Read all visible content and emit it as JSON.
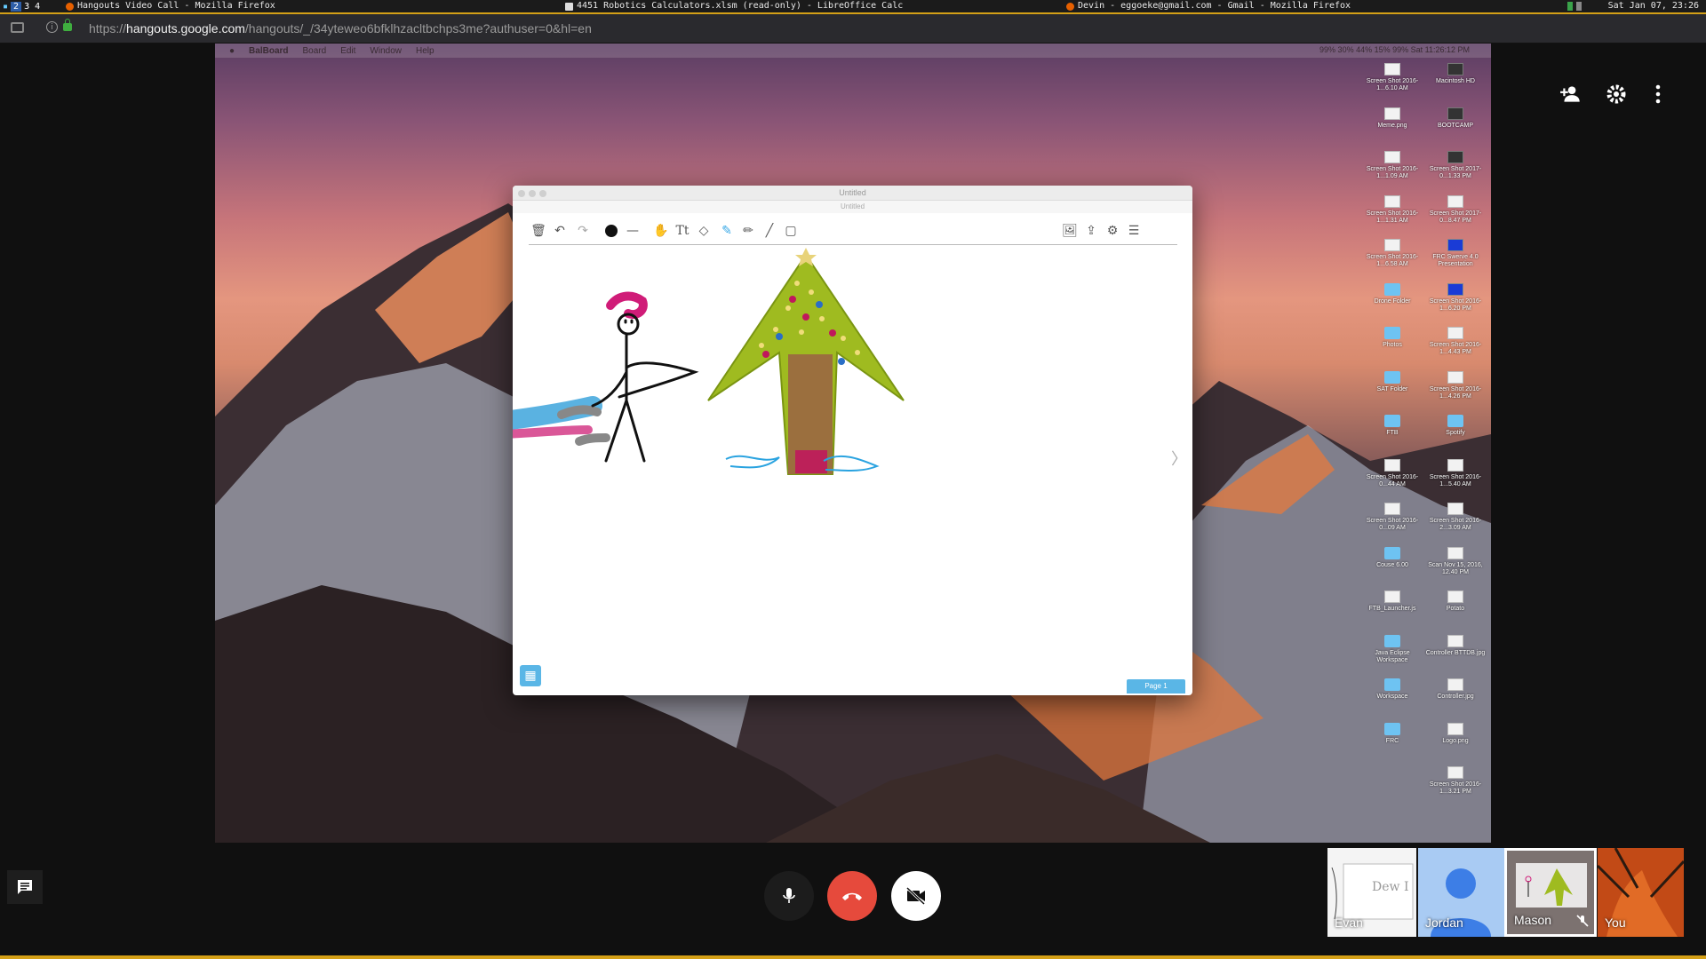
{
  "wm": {
    "workspaces": [
      "2",
      "3",
      "4"
    ],
    "window_titles": [
      "Hangouts Video Call - Mozilla Firefox",
      "4451 Robotics Calculators.xlsm (read-only) - LibreOffice Calc",
      "Devin - eggoeke@gmail.com - Gmail - Mozilla Firefox"
    ],
    "clock": "Sat Jan 07, 23:26"
  },
  "browser": {
    "url_prefix": "https://",
    "url_host": "hangouts.google.com",
    "url_path": "/hangouts/_/34yteweo6bfklhzacltbchps3me?authuser=0&hl=en"
  },
  "shared_screen": {
    "menubar": [
      "BalBoard",
      "Board",
      "Edit",
      "Window",
      "Help"
    ],
    "status": "99%  30%  44%  15%  99%  Sat 11:26:12 PM",
    "desktop_icons": [
      {
        "label": "Screen Shot 2016-1...6.10 AM",
        "kind": "file"
      },
      {
        "label": "Macintosh HD",
        "kind": "dark"
      },
      {
        "label": "Meme.png",
        "kind": "file"
      },
      {
        "label": "BOOTCAMP",
        "kind": "dark"
      },
      {
        "label": "Screen Shot 2016-1...1.09 AM",
        "kind": "file"
      },
      {
        "label": "Screen Shot 2017-0...1.33 PM",
        "kind": "dark"
      },
      {
        "label": "Screen Shot 2016-1...1.31 AM",
        "kind": "file"
      },
      {
        "label": "Screen Shot 2017-0...8.47 PM",
        "kind": "file"
      },
      {
        "label": "Screen Shot 2016-1...6.58 AM",
        "kind": "file"
      },
      {
        "label": "FRC Swerve 4.0 Presentation",
        "kind": "blue"
      },
      {
        "label": "Drone Folder",
        "kind": "folder"
      },
      {
        "label": "Screen Shot 2016-1...6.20 PM",
        "kind": "blue"
      },
      {
        "label": "Photos",
        "kind": "folder"
      },
      {
        "label": "Screen Shot 2016-1...4.43 PM",
        "kind": "file"
      },
      {
        "label": "SAT Folder",
        "kind": "folder"
      },
      {
        "label": "Screen Shot 2016-1...4.26 PM",
        "kind": "file"
      },
      {
        "label": "FTB",
        "kind": "folder"
      },
      {
        "label": "Spotify",
        "kind": "folder"
      },
      {
        "label": "Screen Shot 2016-0...44 AM",
        "kind": "file"
      },
      {
        "label": "Screen Shot 2016-1...5.40 AM",
        "kind": "file"
      },
      {
        "label": "Screen Shot 2016-0...09 AM",
        "kind": "file"
      },
      {
        "label": "Screen Shot 2016-2...3.09 AM",
        "kind": "file"
      },
      {
        "label": "Couse 6.00",
        "kind": "folder"
      },
      {
        "label": "Scan Nov 15, 2016, 12.40 PM",
        "kind": "file"
      },
      {
        "label": "FTB_Launcher.js",
        "kind": "file"
      },
      {
        "label": "Potato",
        "kind": "file"
      },
      {
        "label": "Java Eclipse Workspace",
        "kind": "folder"
      },
      {
        "label": "Controller BTTDB.jpg",
        "kind": "file"
      },
      {
        "label": "Workspace",
        "kind": "folder"
      },
      {
        "label": "Controller.jpg",
        "kind": "file"
      },
      {
        "label": "FRC",
        "kind": "folder"
      },
      {
        "label": "Logo.png",
        "kind": "file"
      },
      {
        "label": "",
        "kind": "none"
      },
      {
        "label": "Screen Shot 2016-1...3.21 PM",
        "kind": "file"
      }
    ],
    "whiteboard": {
      "title": "Untitled",
      "subtitle": "Untitled",
      "page_label": "Page 1"
    }
  },
  "participants": [
    {
      "name": "Evan"
    },
    {
      "name": "Jordan"
    },
    {
      "name": "Mason"
    },
    {
      "name": "You"
    }
  ],
  "icons": {
    "add_person": "add-person-icon",
    "settings": "gear-icon",
    "more": "more-vert-icon",
    "chat": "chat-icon",
    "mic": "mic-icon",
    "end_call": "end-call-icon",
    "camera_off": "camera-off-icon"
  }
}
